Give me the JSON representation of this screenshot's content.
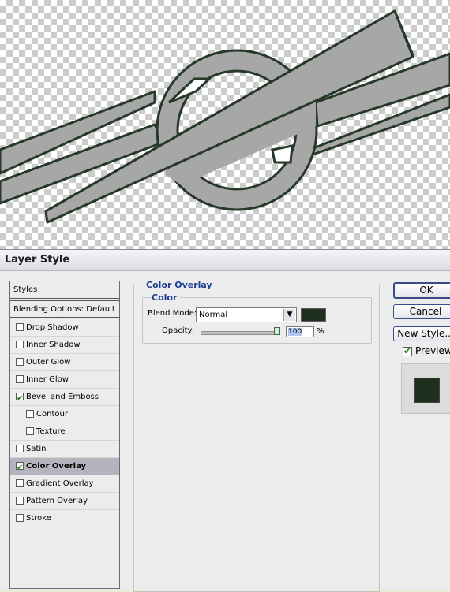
{
  "dialog": {
    "title": "Layer Style",
    "ok_label": "OK",
    "cancel_label": "Cancel",
    "new_style_label": "New Style...",
    "preview_label": "Preview",
    "preview_checked": true
  },
  "styles": {
    "header": "Styles",
    "blending_options": "Blending Options: Default",
    "items": [
      {
        "label": "Drop Shadow",
        "checked": false
      },
      {
        "label": "Inner Shadow",
        "checked": false
      },
      {
        "label": "Outer Glow",
        "checked": false
      },
      {
        "label": "Inner Glow",
        "checked": false
      },
      {
        "label": "Bevel and Emboss",
        "checked": true
      },
      {
        "label": "Contour",
        "checked": false
      },
      {
        "label": "Texture",
        "checked": false
      },
      {
        "label": "Satin",
        "checked": false
      },
      {
        "label": "Color Overlay",
        "checked": true,
        "selected": true
      },
      {
        "label": "Gradient Overlay",
        "checked": false
      },
      {
        "label": "Pattern Overlay",
        "checked": false
      },
      {
        "label": "Stroke",
        "checked": false
      }
    ]
  },
  "panel": {
    "section_title": "Color Overlay",
    "group_title": "Color",
    "blend_mode_label": "Blend Mode:",
    "blend_mode_value": "Normal",
    "opacity_label": "Opacity:",
    "opacity_value": "100",
    "opacity_unit": "%",
    "overlay_color": "#20301f"
  },
  "canvas": {
    "shape_fill": "#a7a7a8",
    "shape_stroke": "#263828"
  }
}
